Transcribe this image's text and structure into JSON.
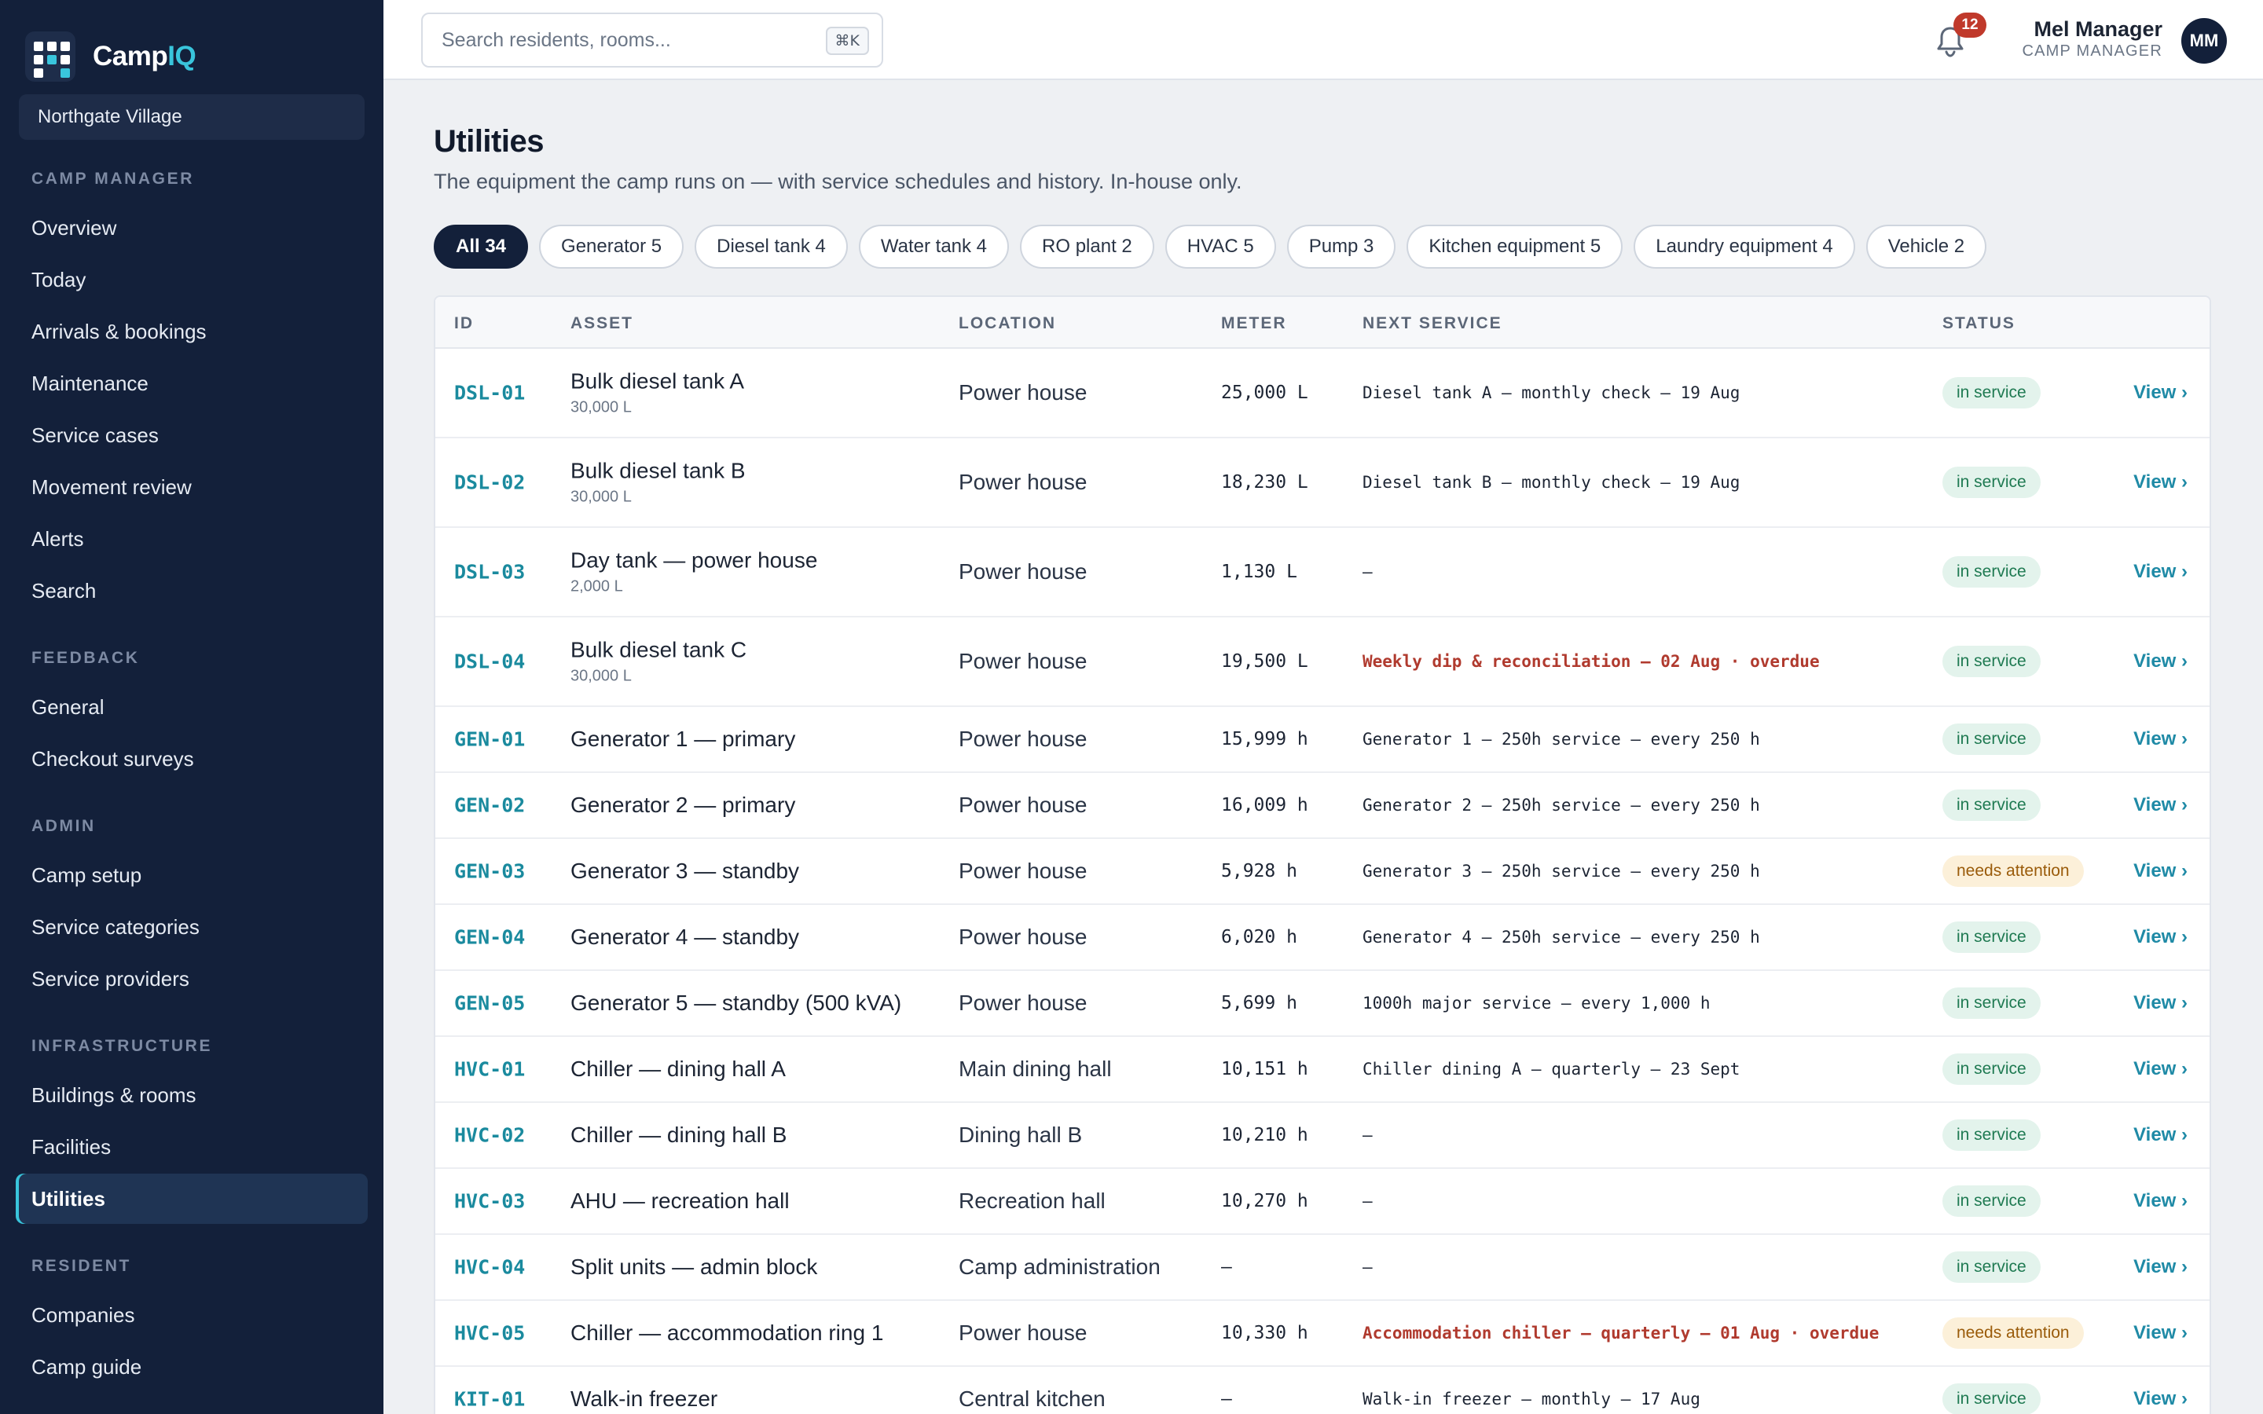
{
  "app": {
    "name_main": "Camp",
    "name_accent": "IQ"
  },
  "camp_selector": {
    "value": "Northgate Village"
  },
  "sidebar": {
    "sections": [
      {
        "title": "CAMP MANAGER",
        "items": [
          "Overview",
          "Today",
          "Arrivals & bookings",
          "Maintenance",
          "Service cases",
          "Movement review",
          "Alerts",
          "Search"
        ]
      },
      {
        "title": "FEEDBACK",
        "items": [
          "General",
          "Checkout surveys"
        ]
      },
      {
        "title": "ADMIN",
        "items": [
          "Camp setup",
          "Service categories",
          "Service providers"
        ]
      },
      {
        "title": "INFRASTRUCTURE",
        "items": [
          "Buildings & rooms",
          "Facilities",
          "Utilities"
        ]
      },
      {
        "title": "RESIDENT",
        "items": [
          "Companies",
          "Camp guide"
        ]
      }
    ],
    "active_item": "Utilities"
  },
  "header": {
    "search_placeholder": "Search residents, rooms...",
    "search_shortcut": "⌘K",
    "notification_count": "12",
    "user_name": "Mel Manager",
    "user_role": "CAMP MANAGER",
    "user_initials": "MM"
  },
  "page": {
    "title": "Utilities",
    "subtitle": "The equipment the camp runs on — with service schedules and history. In-house only."
  },
  "filters": [
    {
      "label": "All 34",
      "active": true
    },
    {
      "label": "Generator 5",
      "active": false
    },
    {
      "label": "Diesel tank 4",
      "active": false
    },
    {
      "label": "Water tank 4",
      "active": false
    },
    {
      "label": "RO plant 2",
      "active": false
    },
    {
      "label": "HVAC 5",
      "active": false
    },
    {
      "label": "Pump 3",
      "active": false
    },
    {
      "label": "Kitchen equipment 5",
      "active": false
    },
    {
      "label": "Laundry equipment 4",
      "active": false
    },
    {
      "label": "Vehicle 2",
      "active": false
    }
  ],
  "table": {
    "columns": {
      "id": "ID",
      "asset": "ASSET",
      "location": "LOCATION",
      "meter": "METER",
      "next": "NEXT SERVICE",
      "status": "STATUS"
    },
    "view_label": "View ›",
    "rows": [
      {
        "id": "DSL-01",
        "asset": "Bulk diesel tank A",
        "capacity": "30,000 L",
        "location": "Power house",
        "meter": "25,000 L",
        "next": "Diesel tank A — monthly check — 19 Aug",
        "overdue": false,
        "status": "in service",
        "status_type": "ok"
      },
      {
        "id": "DSL-02",
        "asset": "Bulk diesel tank B",
        "capacity": "30,000 L",
        "location": "Power house",
        "meter": "18,230 L",
        "next": "Diesel tank B — monthly check — 19 Aug",
        "overdue": false,
        "status": "in service",
        "status_type": "ok"
      },
      {
        "id": "DSL-03",
        "asset": "Day tank — power house",
        "capacity": "2,000 L",
        "location": "Power house",
        "meter": "1,130 L",
        "next": "—",
        "overdue": false,
        "status": "in service",
        "status_type": "ok"
      },
      {
        "id": "DSL-04",
        "asset": "Bulk diesel tank C",
        "capacity": "30,000 L",
        "location": "Power house",
        "meter": "19,500 L",
        "next": "Weekly dip & reconciliation — 02 Aug · overdue",
        "overdue": true,
        "status": "in service",
        "status_type": "ok"
      },
      {
        "id": "GEN-01",
        "asset": "Generator 1 — primary",
        "capacity": "",
        "location": "Power house",
        "meter": "15,999 h",
        "next": "Generator 1 — 250h service — every 250 h",
        "overdue": false,
        "status": "in service",
        "status_type": "ok"
      },
      {
        "id": "GEN-02",
        "asset": "Generator 2 — primary",
        "capacity": "",
        "location": "Power house",
        "meter": "16,009 h",
        "next": "Generator 2 — 250h service — every 250 h",
        "overdue": false,
        "status": "in service",
        "status_type": "ok"
      },
      {
        "id": "GEN-03",
        "asset": "Generator 3 — standby",
        "capacity": "",
        "location": "Power house",
        "meter": "5,928 h",
        "next": "Generator 3 — 250h service — every 250 h",
        "overdue": false,
        "status": "needs attention",
        "status_type": "warn"
      },
      {
        "id": "GEN-04",
        "asset": "Generator 4 — standby",
        "capacity": "",
        "location": "Power house",
        "meter": "6,020 h",
        "next": "Generator 4 — 250h service — every 250 h",
        "overdue": false,
        "status": "in service",
        "status_type": "ok"
      },
      {
        "id": "GEN-05",
        "asset": "Generator 5 — standby (500 kVA)",
        "capacity": "",
        "location": "Power house",
        "meter": "5,699 h",
        "next": "1000h major service — every 1,000 h",
        "overdue": false,
        "status": "in service",
        "status_type": "ok"
      },
      {
        "id": "HVC-01",
        "asset": "Chiller — dining hall A",
        "capacity": "",
        "location": "Main dining hall",
        "meter": "10,151 h",
        "next": "Chiller dining A — quarterly — 23 Sept",
        "overdue": false,
        "status": "in service",
        "status_type": "ok"
      },
      {
        "id": "HVC-02",
        "asset": "Chiller — dining hall B",
        "capacity": "",
        "location": "Dining hall B",
        "meter": "10,210 h",
        "next": "—",
        "overdue": false,
        "status": "in service",
        "status_type": "ok"
      },
      {
        "id": "HVC-03",
        "asset": "AHU — recreation hall",
        "capacity": "",
        "location": "Recreation hall",
        "meter": "10,270 h",
        "next": "—",
        "overdue": false,
        "status": "in service",
        "status_type": "ok"
      },
      {
        "id": "HVC-04",
        "asset": "Split units — admin block",
        "capacity": "",
        "location": "Camp administration",
        "meter": "–",
        "next": "—",
        "overdue": false,
        "status": "in service",
        "status_type": "ok"
      },
      {
        "id": "HVC-05",
        "asset": "Chiller — accommodation ring 1",
        "capacity": "",
        "location": "Power house",
        "meter": "10,330 h",
        "next": "Accommodation chiller — quarterly — 01 Aug · overdue",
        "overdue": true,
        "status": "needs attention",
        "status_type": "warn"
      },
      {
        "id": "KIT-01",
        "asset": "Walk-in freezer",
        "capacity": "",
        "location": "Central kitchen",
        "meter": "–",
        "next": "Walk-in freezer — monthly — 17 Aug",
        "overdue": false,
        "status": "in service",
        "status_type": "ok"
      }
    ]
  }
}
